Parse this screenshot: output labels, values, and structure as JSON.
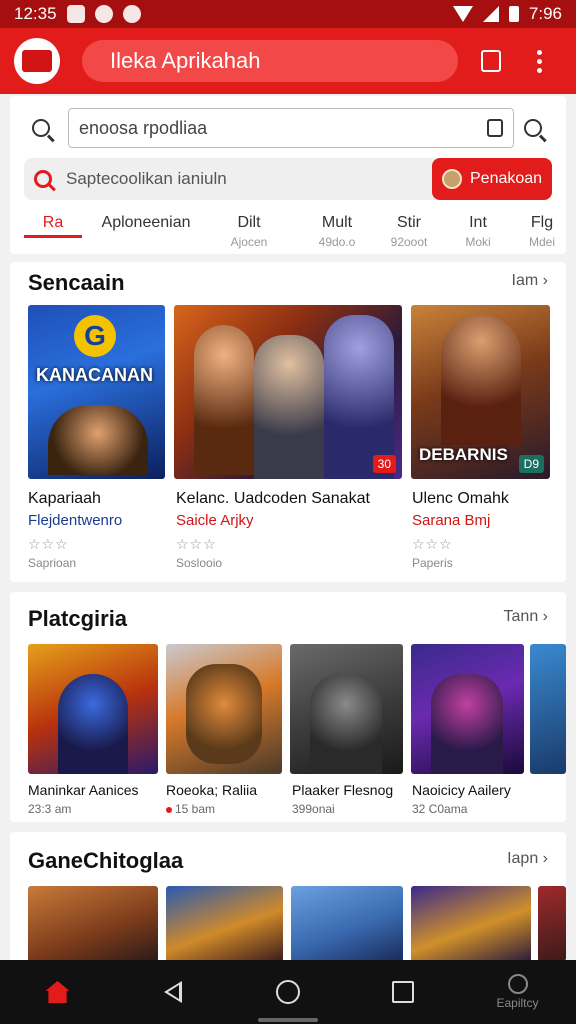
{
  "status_bar": {
    "time": "12:35",
    "right_text": "7:96"
  },
  "app_bar": {
    "title": "Ileka Aprikahah"
  },
  "search": {
    "input_value": "enoosa rpodliaa",
    "suggestion": "Saptecoolikan ianiuln",
    "action_button": "Penakoan"
  },
  "tabs": [
    {
      "label": "Ra",
      "sub": ""
    },
    {
      "label": "Aploneenian",
      "sub": ""
    },
    {
      "label": "Dilt",
      "sub": "Ajocen"
    },
    {
      "label": "Mult",
      "sub": "49do.o"
    },
    {
      "label": "Stir",
      "sub": "92ooot"
    },
    {
      "label": "Int",
      "sub": "Moki"
    },
    {
      "label": "Flg",
      "sub": "Mdei"
    }
  ],
  "section1": {
    "title": "Sencaain",
    "see_more": "Iam ›",
    "cards": [
      {
        "title": "Kapariaah",
        "sub": "Flejdentwenro",
        "meta": "Saprioan",
        "art_text": "KANACANAN",
        "stars": "☆☆☆"
      },
      {
        "title": "Kelanc. Uadcoden Sanakat",
        "sub": "Saicle Arjky",
        "meta": "Soslooio",
        "badge": "30",
        "stars": "☆☆☆"
      },
      {
        "title": "Ulenc Omahk",
        "sub": "Sarana Bmj",
        "meta": "Paperis",
        "art_text": "DEBARNIS",
        "badge": "D9",
        "stars": "☆☆☆"
      }
    ]
  },
  "section2": {
    "title": "Platcgiria",
    "see_more": "Tann ›",
    "cards": [
      {
        "title": "Maninkar Aanices",
        "meta": "23:3 am"
      },
      {
        "title": "Roeoka; Raliia",
        "meta": "15 bam"
      },
      {
        "title": "Plaaker Flesnog",
        "meta": "399onai"
      },
      {
        "title": "Naoicicy Aailery",
        "meta": "32 C0ama"
      }
    ]
  },
  "section3": {
    "title": "GaneChitoglaa",
    "see_more": "Iapn ›"
  },
  "bottom_nav": {
    "profile_label": "Eapiltcy"
  },
  "colors": {
    "primary": "#e21b1b",
    "dark_red": "#a50f0f"
  }
}
